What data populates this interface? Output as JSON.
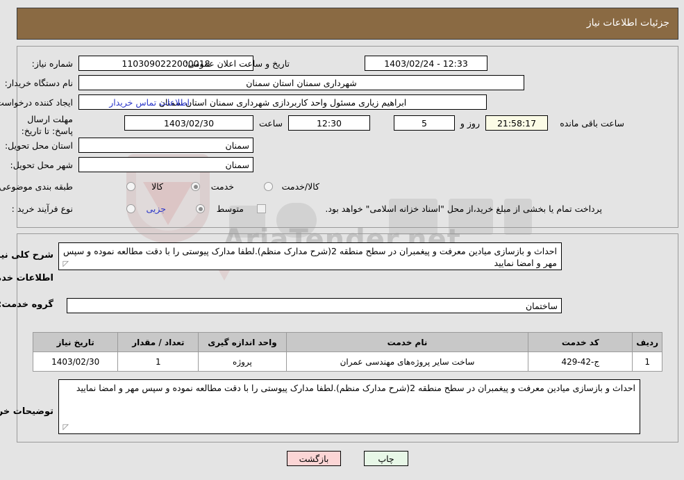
{
  "header": {
    "title": "جزئیات اطلاعات نیاز"
  },
  "watermark": {
    "text": "AriaTender.net"
  },
  "need_info": {
    "need_number_label": "شماره نیاز:",
    "need_number_value": "1103090222000018",
    "public_announce_label": "تاریخ و ساعت اعلان عمومی:",
    "public_announce_value": "12:33 - 1403/02/24",
    "buyer_org_label": "نام دستگاه خریدار:",
    "buyer_org_value": "شهرداری سمنان استان سمنان",
    "creator_label": "ایجاد کننده درخواست:",
    "creator_value": "ابراهیم زیاری مسئول واحد کاربردازی شهرداری سمنان استان سمنان",
    "contact_link": "اطلاعات تماس خریدار",
    "deadline_label": "مهلت ارسال پاسخ: تا تاریخ:",
    "deadline_date": "1403/02/30",
    "hour_label": "ساعت",
    "deadline_time": "12:30",
    "days_remaining": "5",
    "days_word": "روز و",
    "countdown": "21:58:17",
    "remaining_suffix": "ساعت باقی مانده",
    "province_label": "استان محل تحویل:",
    "province_value": "سمنان",
    "city_label": "شهر محل تحویل:",
    "city_value": "سمنان",
    "category_label": "طبقه بندی موضوعی:",
    "category_options": [
      {
        "label": "کالا",
        "checked": false
      },
      {
        "label": "خدمت",
        "checked": true
      },
      {
        "label": "کالا/خدمت",
        "checked": false
      }
    ],
    "process_label": "نوع فرآیند خرید :",
    "process_options": [
      {
        "label": "جزیی",
        "checked": false
      },
      {
        "label": "متوسط",
        "checked": true
      }
    ],
    "treasury_checkbox_text": "پرداخت تمام یا بخشی از مبلغ خرید،از محل \"اسناد خزانه اسلامی\" خواهد بود.",
    "treasury_checked": false
  },
  "need_detail": {
    "summary_label": "شرح کلی نیاز:",
    "summary_value": "احداث و بازسازی میادین معرفت و پیغمبران در سطح منطقه 2(شرح مدارک منظم).لطفا مدارک پیوستی را با دقت مطالعه نموده و سپس مهر و امضا نمایید",
    "services_heading": "اطلاعات خدمات مورد نیاز",
    "service_group_label": "گروه خدمت:",
    "service_group_value": "ساختمان",
    "table": {
      "columns": [
        "ردیف",
        "کد خدمت",
        "نام خدمت",
        "واحد اندازه گیری",
        "تعداد / مقدار",
        "تاریخ نیاز"
      ],
      "rows": [
        {
          "row_no": "1",
          "service_code": "ج-42-429",
          "service_name": "ساخت سایر پروژه‌های مهندسی عمران",
          "unit": "پروژه",
          "quantity": "1",
          "need_date": "1403/02/30"
        }
      ]
    },
    "buyer_notes_label": "توضیحات خریدار:",
    "buyer_notes_value": "احداث و بازسازی میادین معرفت و پیغمبران در سطح منطقه 2(شرح مدارک منظم).لطفا مدارک پیوستی را با دقت مطالعه نموده و سپس مهر و امضا نمایید"
  },
  "footer": {
    "print_label": "چاپ",
    "back_label": "بازگشت"
  },
  "colors": {
    "header_bg": "#8a6a43",
    "page_bg": "#e4e4e4",
    "link": "#2b37c9",
    "print_btn": "#e7f7e7",
    "back_btn": "#fbd5d5",
    "countdown_bg": "#fbfbe6"
  }
}
